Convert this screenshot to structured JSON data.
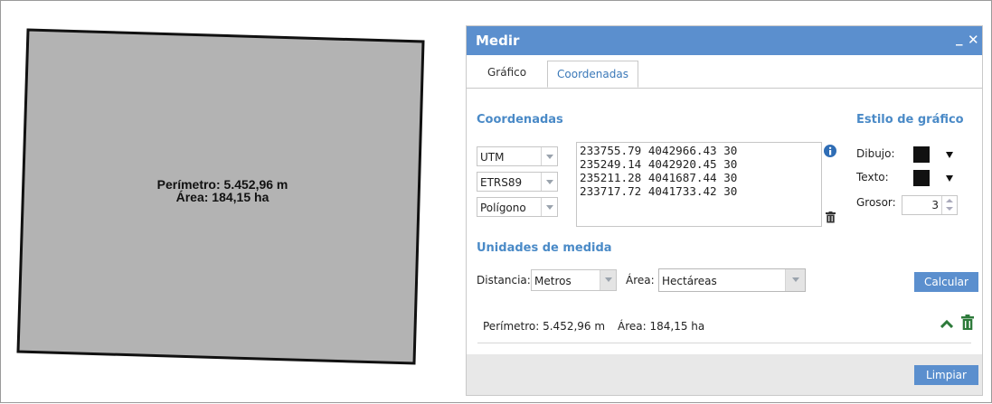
{
  "map": {
    "perimeter_label": "Perímetro: 5.452,96 m",
    "area_label": "Área: 184,15 ha",
    "polygon_fill": "#b3b3b3",
    "polygon_stroke": "#111111"
  },
  "panel": {
    "title": "Medir",
    "minimize_label": "_",
    "close_label": "✕",
    "tabs": [
      {
        "label": "Gráfico",
        "active": false
      },
      {
        "label": "Coordenadas",
        "active": true
      }
    ],
    "coordinates": {
      "section_title": "Coordenadas",
      "system_select": "UTM",
      "datum_select": "ETRS89",
      "geometry_select": "Polígono",
      "rows": [
        "233755.79 4042966.43 30",
        "235249.14 4042920.45 30",
        "235211.28 4041687.44 30",
        "233717.72 4041733.42 30"
      ]
    },
    "style": {
      "section_title": "Estilo de gráfico",
      "draw_label": "Dibujo:",
      "text_label": "Texto:",
      "thickness_label": "Grosor:",
      "thickness_value": "3",
      "draw_color": "#111111",
      "text_color": "#111111"
    },
    "units": {
      "section_title": "Unidades de medida",
      "distance_label": "Distancia:",
      "distance_value": "Metros",
      "area_label": "Área:",
      "area_value": "Hectáreas",
      "calculate_button": "Calcular"
    },
    "result": {
      "perimeter": "Perímetro: 5.452,96 m",
      "area": "Área: 184,15 ha"
    },
    "clear_button": "Limpiar",
    "accent_color": "#5b8fce"
  }
}
